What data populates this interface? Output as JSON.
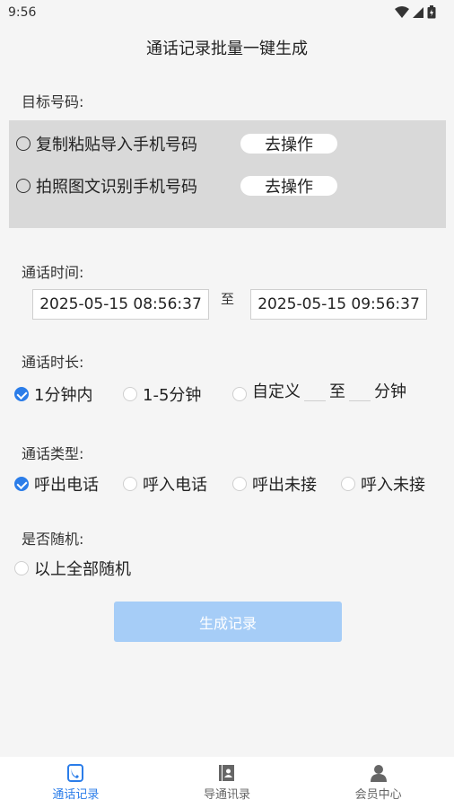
{
  "status": {
    "time": "9:56"
  },
  "title": "通话记录批量一键生成",
  "target": {
    "label": "目标号码:",
    "options": [
      {
        "label": "复制粘贴导入手机号码",
        "button": "去操作"
      },
      {
        "label": "拍照图文识别手机号码",
        "button": "去操作"
      }
    ]
  },
  "call_time": {
    "label": "通话时间:",
    "start": "2025-05-15 08:56:37",
    "to": "至",
    "end": "2025-05-15 09:56:37"
  },
  "duration": {
    "label": "通话时长:",
    "options": [
      "1分钟内",
      "1-5分钟",
      "自定义"
    ],
    "to": "至",
    "unit": "分钟",
    "selected": "1分钟内"
  },
  "call_type": {
    "label": "通话类型:",
    "options": [
      "呼出电话",
      "呼入电话",
      "呼出未接",
      "呼入未接"
    ],
    "selected": "呼出电话"
  },
  "random": {
    "label": "是否随机:",
    "option": "以上全部随机"
  },
  "generate_button": "生成记录",
  "tabs": [
    {
      "label": "通话记录",
      "icon": "phone-record-icon",
      "active": true
    },
    {
      "label": "导通讯录",
      "icon": "contacts-icon",
      "active": false
    },
    {
      "label": "会员中心",
      "icon": "user-icon",
      "active": false
    }
  ],
  "colors": {
    "accent": "#2b7de9",
    "button_disabled": "#a6cdf7",
    "panel": "#d9d9d9"
  }
}
